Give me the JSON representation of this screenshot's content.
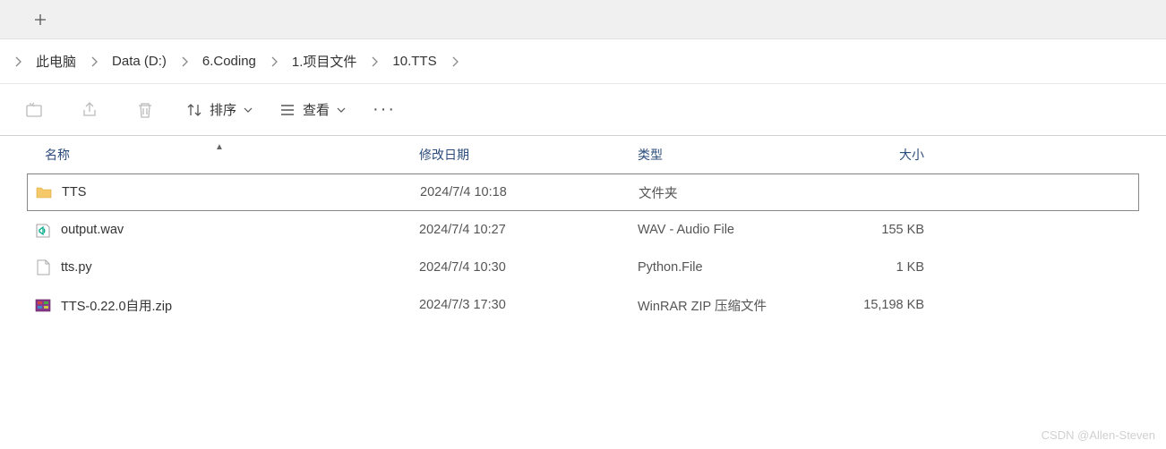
{
  "breadcrumb": [
    {
      "label": "此电脑"
    },
    {
      "label": "Data (D:)"
    },
    {
      "label": "6.Coding"
    },
    {
      "label": "1.项目文件"
    },
    {
      "label": "10.TTS"
    }
  ],
  "toolbar": {
    "sort_label": "排序",
    "view_label": "查看"
  },
  "columns": {
    "name": "名称",
    "date": "修改日期",
    "type": "类型",
    "size": "大小"
  },
  "files": [
    {
      "name": "TTS",
      "date": "2024/7/4 10:18",
      "type": "文件夹",
      "size": "",
      "icon": "folder",
      "selected": true
    },
    {
      "name": "output.wav",
      "date": "2024/7/4 10:27",
      "type": "WAV - Audio File",
      "size": "155 KB",
      "icon": "audio",
      "selected": false
    },
    {
      "name": "tts.py",
      "date": "2024/7/4 10:30",
      "type": "Python.File",
      "size": "1 KB",
      "icon": "file",
      "selected": false
    },
    {
      "name": "TTS-0.22.0自用.zip",
      "date": "2024/7/3 17:30",
      "type": "WinRAR ZIP 压缩文件",
      "size": "15,198 KB",
      "icon": "zip",
      "selected": false
    }
  ],
  "watermark": "CSDN @Allen-Steven"
}
